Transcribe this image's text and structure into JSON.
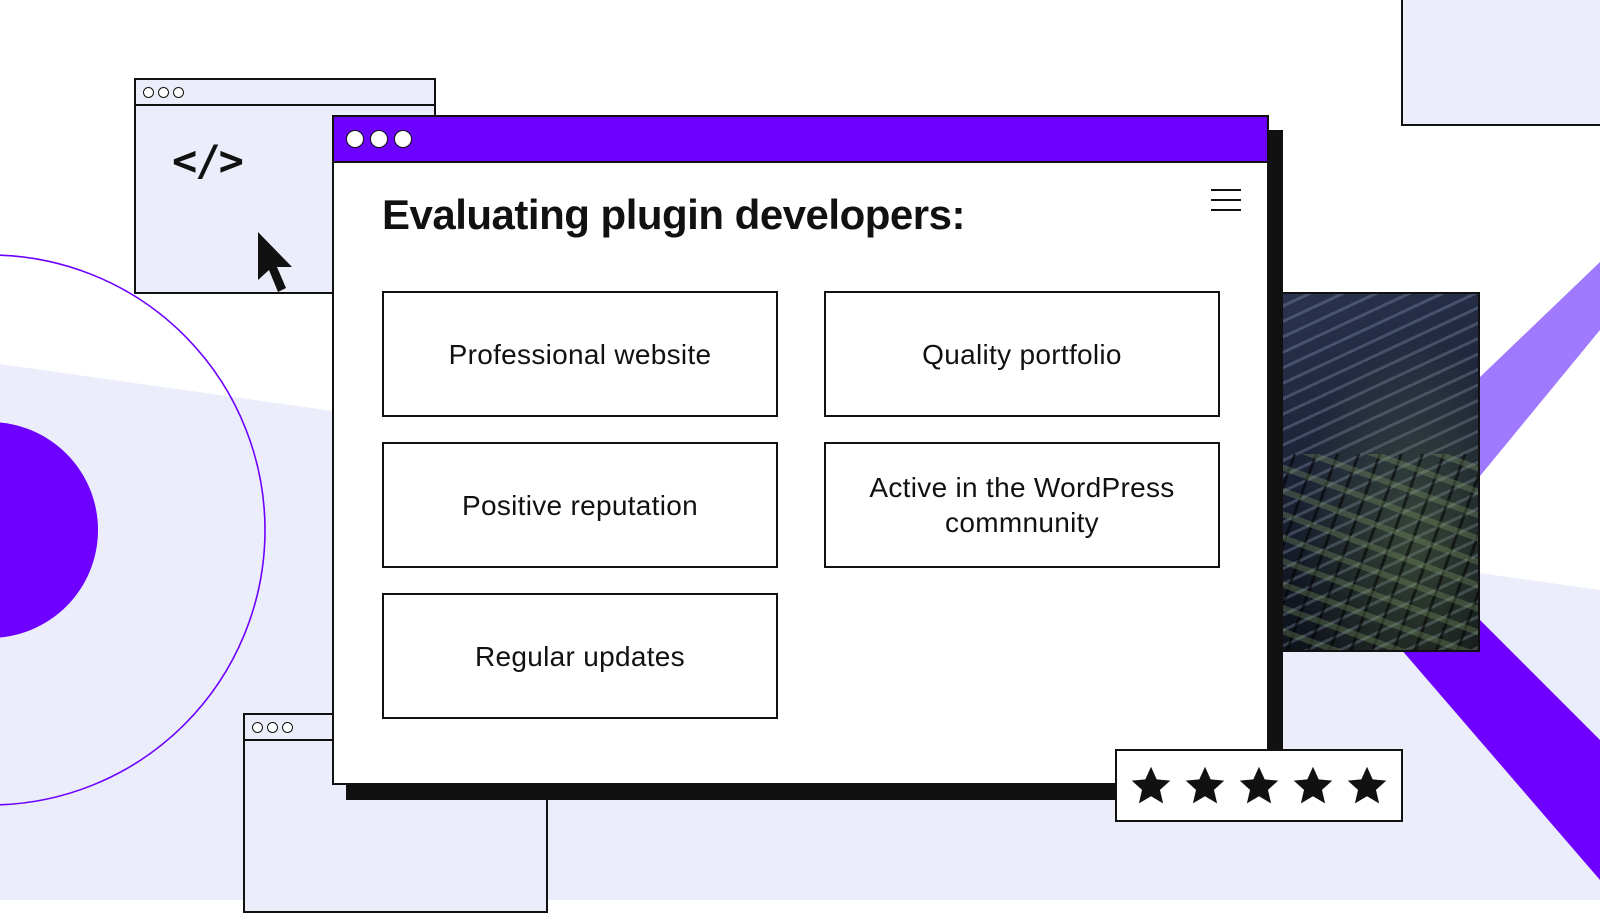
{
  "title": "Evaluating plugin developers:",
  "criteria": [
    "Professional website",
    "Quality portfolio",
    "Positive reputation",
    "Active in the WordPress commnunity",
    "Regular updates"
  ],
  "code_symbol": "</>",
  "rating": {
    "stars": 5,
    "max": 5
  },
  "colors": {
    "accent": "#6d00ff",
    "accent_light": "#9f7aff",
    "background_panel": "#ebeefa",
    "outline": "#111111"
  },
  "icons": [
    "code-icon",
    "cursor-icon",
    "menu-icon",
    "star-icon"
  ]
}
